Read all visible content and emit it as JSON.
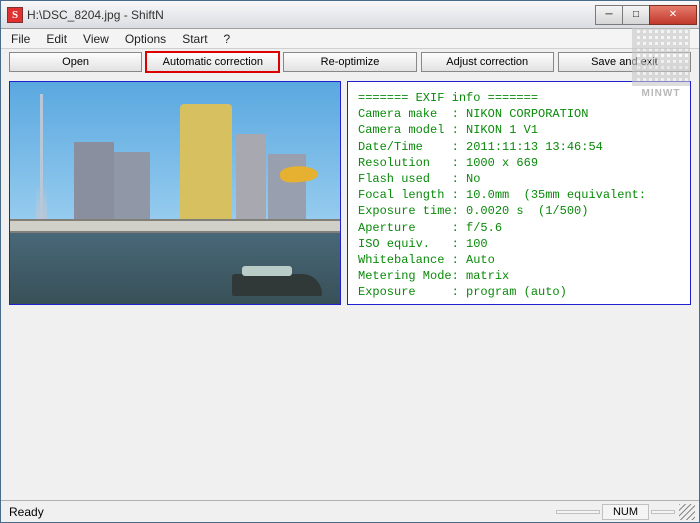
{
  "window": {
    "title": "H:\\DSC_8204.jpg - ShiftN",
    "app_icon_letter": "S"
  },
  "menu": {
    "file": "File",
    "edit": "Edit",
    "view": "View",
    "options": "Options",
    "start": "Start",
    "help": "?"
  },
  "toolbar": {
    "open": "Open",
    "auto": "Automatic correction",
    "reopt": "Re-optimize",
    "adjust": "Adjust correction",
    "save": "Save and exit"
  },
  "exif": {
    "header": "======= EXIF info =======",
    "make": "Camera make  : NIKON CORPORATION",
    "model": "Camera model : NIKON 1 V1",
    "datetime": "Date/Time    : 2011:11:13 13:46:54",
    "res": "Resolution   : 1000 x 669",
    "flash": "Flash used   : No",
    "focal": "Focal length : 10.0mm  (35mm equivalent:",
    "exptime": "Exposure time: 0.0020 s  (1/500)",
    "aperture": "Aperture     : f/5.6",
    "iso": "ISO equiv.   : 100",
    "wb": "Whitebalance : Auto",
    "meter": "Metering Mode: matrix",
    "exposure": "Exposure     : program (auto)"
  },
  "status": {
    "ready": "Ready",
    "num": "NUM"
  },
  "watermark": {
    "text": "MINWT"
  }
}
